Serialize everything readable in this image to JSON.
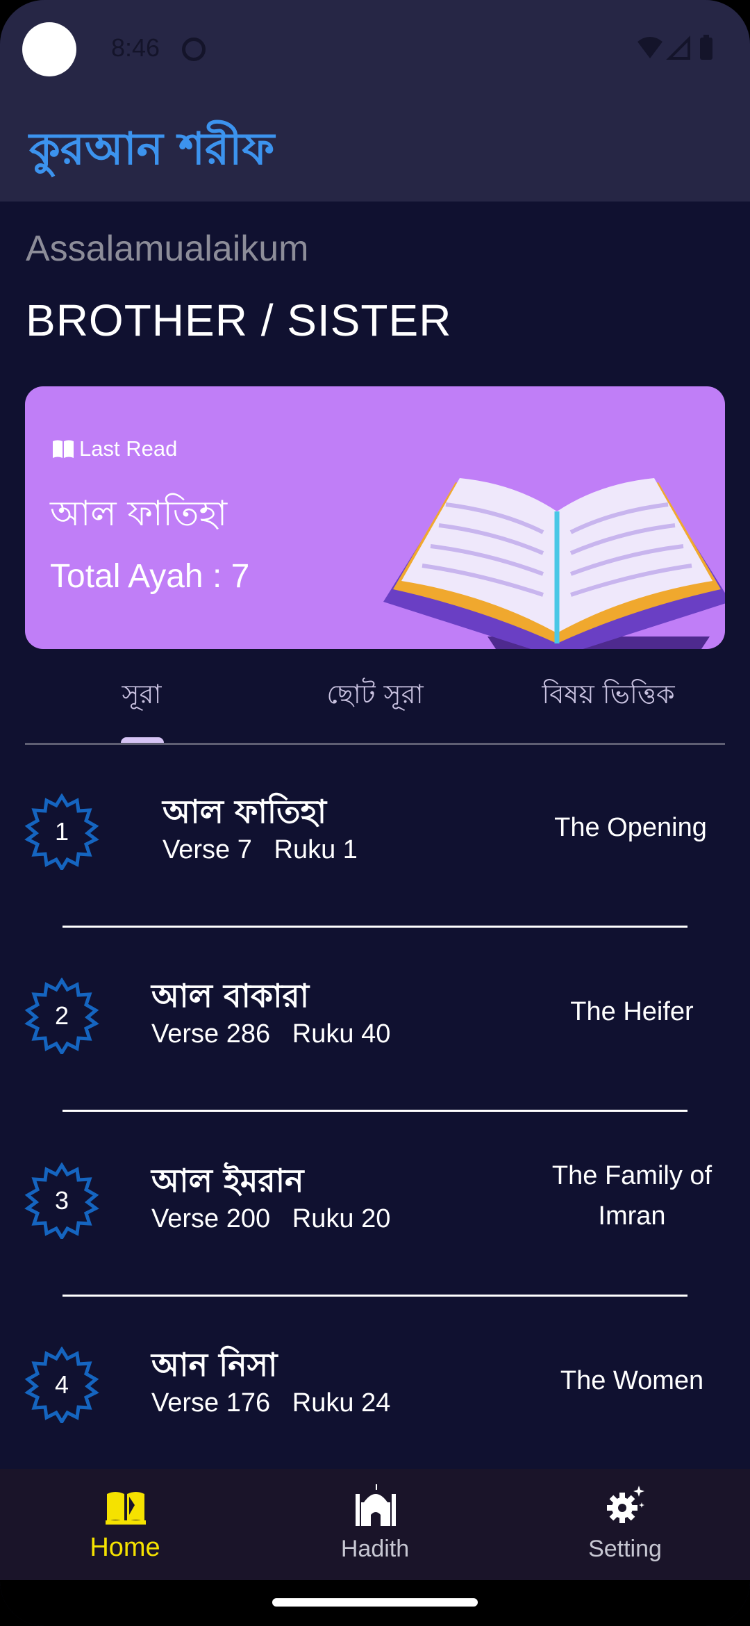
{
  "status_bar": {
    "time": "8:46"
  },
  "app_bar": {
    "title": "কুরআন শরীফ"
  },
  "greeting": {
    "salutation": "Assalamualaikum",
    "name": "BROTHER / SISTER"
  },
  "last_read": {
    "label": "Last Read",
    "surah": "আল ফাতিহা",
    "total_ayah": "Total Ayah : 7",
    "icon": "open-book-icon"
  },
  "tabs": [
    {
      "label": "সূরা",
      "active": true
    },
    {
      "label": "ছোট সূরা",
      "active": false
    },
    {
      "label": "বিষয় ভিত্তিক",
      "active": false
    }
  ],
  "surahs": [
    {
      "number": "1",
      "name": "আল ফাতিহা",
      "meta": "Verse 7   Ruku 1",
      "english": "The Opening"
    },
    {
      "number": "2",
      "name": "আল বাকারা",
      "meta": "Verse 286   Ruku 40",
      "english": "The Heifer"
    },
    {
      "number": "3",
      "name": "আল ইমরান",
      "meta": "Verse 200   Ruku 20",
      "english": "The Family of Imran"
    },
    {
      "number": "4",
      "name": "আন নিসা",
      "meta": "Verse 176   Ruku 24",
      "english": "The Women"
    }
  ],
  "bottom_nav": [
    {
      "label": "Home",
      "icon": "quran-book-icon",
      "active": true
    },
    {
      "label": "Hadith",
      "icon": "mosque-icon",
      "active": false
    },
    {
      "label": "Setting",
      "icon": "gear-icon",
      "active": false
    }
  ],
  "colors": {
    "background": "#101130",
    "app_bar": "#262645",
    "title_accent": "#3c93ee",
    "card": "#c07ef7",
    "badge": "#1565c0",
    "nav_active": "#f5e200"
  }
}
